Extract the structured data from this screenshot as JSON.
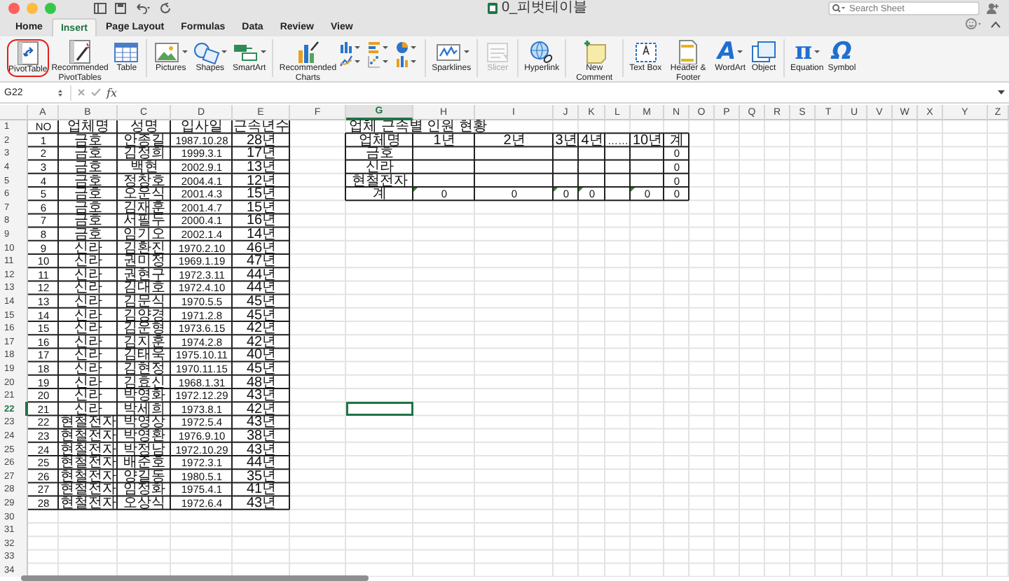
{
  "window": {
    "title": "0_피벗테이블"
  },
  "search": {
    "placeholder": "Search Sheet"
  },
  "tabs": [
    {
      "label": "Home",
      "selected": false
    },
    {
      "label": "Insert",
      "selected": true
    },
    {
      "label": "Page Layout",
      "selected": false
    },
    {
      "label": "Formulas",
      "selected": false
    },
    {
      "label": "Data",
      "selected": false
    },
    {
      "label": "Review",
      "selected": false
    },
    {
      "label": "View",
      "selected": false
    }
  ],
  "ribbon": {
    "groups": [
      {
        "kind": "buttons",
        "buttons": [
          {
            "label": "PivotTable",
            "circled": true,
            "disabled": false,
            "dropdown": false
          },
          {
            "label": "Recommended PivotTables",
            "circled": false,
            "disabled": false,
            "dropdown": false
          },
          {
            "label": "Table",
            "circled": false,
            "disabled": false,
            "dropdown": false
          }
        ]
      },
      {
        "kind": "buttons",
        "buttons": [
          {
            "label": "Pictures",
            "circled": false,
            "disabled": false,
            "dropdown": true
          },
          {
            "label": "Shapes",
            "circled": false,
            "disabled": false,
            "dropdown": true
          },
          {
            "label": "SmartArt",
            "circled": false,
            "disabled": false,
            "dropdown": true
          }
        ]
      },
      {
        "kind": "charts",
        "buttons": [
          {
            "label": "Recommended Charts",
            "circled": false,
            "disabled": false,
            "dropdown": false
          }
        ]
      },
      {
        "kind": "buttons",
        "buttons": [
          {
            "label": "Sparklines",
            "circled": false,
            "disabled": false,
            "dropdown": true
          }
        ]
      },
      {
        "kind": "buttons",
        "buttons": [
          {
            "label": "Slicer",
            "circled": false,
            "disabled": true,
            "dropdown": false
          }
        ]
      },
      {
        "kind": "buttons",
        "buttons": [
          {
            "label": "Hyperlink",
            "circled": false,
            "disabled": false,
            "dropdown": false
          }
        ]
      },
      {
        "kind": "buttons",
        "buttons": [
          {
            "label": "New Comment",
            "circled": false,
            "disabled": false,
            "dropdown": false
          }
        ]
      },
      {
        "kind": "buttons",
        "buttons": [
          {
            "label": "Text Box",
            "circled": false,
            "disabled": false,
            "dropdown": false
          },
          {
            "label": "Header & Footer",
            "circled": false,
            "disabled": false,
            "dropdown": false
          },
          {
            "label": "WordArt",
            "icon_glyph": "A",
            "circled": false,
            "disabled": false,
            "dropdown": true
          },
          {
            "label": "Object",
            "circled": false,
            "disabled": false,
            "dropdown": false
          }
        ]
      },
      {
        "kind": "buttons",
        "buttons": [
          {
            "label": "Equation",
            "icon_glyph": "π",
            "circled": false,
            "disabled": false,
            "dropdown": true
          },
          {
            "label": "Symbol",
            "icon_glyph": "Ω",
            "circled": false,
            "disabled": false,
            "dropdown": false
          }
        ]
      }
    ]
  },
  "formula_bar": {
    "name_box": "G22",
    "function_label": "fx"
  },
  "sheet": {
    "columns": [
      {
        "label": "A",
        "selected": false
      },
      {
        "label": "B",
        "selected": false
      },
      {
        "label": "C",
        "selected": false
      },
      {
        "label": "D",
        "selected": false
      },
      {
        "label": "E",
        "selected": false
      },
      {
        "label": "F",
        "selected": false
      },
      {
        "label": "G",
        "selected": true
      },
      {
        "label": "H",
        "selected": false
      },
      {
        "label": "I",
        "selected": false
      },
      {
        "label": "J",
        "selected": false
      },
      {
        "label": "K",
        "selected": false
      },
      {
        "label": "L",
        "selected": false
      },
      {
        "label": "M",
        "selected": false
      },
      {
        "label": "N",
        "selected": false
      },
      {
        "label": "O",
        "selected": false
      },
      {
        "label": "P",
        "selected": false
      },
      {
        "label": "Q",
        "selected": false
      },
      {
        "label": "R",
        "selected": false
      },
      {
        "label": "S",
        "selected": false
      },
      {
        "label": "T",
        "selected": false
      },
      {
        "label": "U",
        "selected": false
      },
      {
        "label": "V",
        "selected": false
      },
      {
        "label": "W",
        "selected": false
      },
      {
        "label": "X",
        "selected": false
      },
      {
        "label": "Y",
        "selected": false
      },
      {
        "label": "Z",
        "selected": false
      }
    ],
    "rows": [
      {
        "label": "1",
        "selected": false
      },
      {
        "label": "2",
        "selected": false
      },
      {
        "label": "3",
        "selected": false
      },
      {
        "label": "4",
        "selected": false
      },
      {
        "label": "5",
        "selected": false
      },
      {
        "label": "6",
        "selected": false
      },
      {
        "label": "7",
        "selected": false
      },
      {
        "label": "8",
        "selected": false
      },
      {
        "label": "9",
        "selected": false
      },
      {
        "label": "10",
        "selected": false
      },
      {
        "label": "11",
        "selected": false
      },
      {
        "label": "12",
        "selected": false
      },
      {
        "label": "13",
        "selected": false
      },
      {
        "label": "14",
        "selected": false
      },
      {
        "label": "15",
        "selected": false
      },
      {
        "label": "16",
        "selected": false
      },
      {
        "label": "17",
        "selected": false
      },
      {
        "label": "18",
        "selected": false
      },
      {
        "label": "19",
        "selected": false
      },
      {
        "label": "20",
        "selected": false
      },
      {
        "label": "21",
        "selected": false
      },
      {
        "label": "22",
        "selected": true
      },
      {
        "label": "23",
        "selected": false
      },
      {
        "label": "24",
        "selected": false
      },
      {
        "label": "25",
        "selected": false
      },
      {
        "label": "26",
        "selected": false
      },
      {
        "label": "27",
        "selected": false
      },
      {
        "label": "28",
        "selected": false
      },
      {
        "label": "29",
        "selected": false
      },
      {
        "label": "30",
        "selected": false
      },
      {
        "label": "31",
        "selected": false
      },
      {
        "label": "32",
        "selected": false
      },
      {
        "label": "33",
        "selected": false
      },
      {
        "label": "34",
        "selected": false
      }
    ],
    "employee_table": {
      "header": [
        "NO",
        "업체명",
        "성명",
        "입사일",
        "근속년수"
      ],
      "rows": [
        [
          "1",
          "금호",
          "안종길",
          "1987.10.28",
          "28년"
        ],
        [
          "2",
          "금호",
          "김정희",
          "1999.3.1",
          "17년"
        ],
        [
          "3",
          "금호",
          "백현",
          "2002.9.1",
          "13년"
        ],
        [
          "4",
          "금호",
          "정창호",
          "2004.4.1",
          "12년"
        ],
        [
          "5",
          "금호",
          "오운식",
          "2001.4.3",
          "15년"
        ],
        [
          "6",
          "금호",
          "김재훈",
          "2001.4.7",
          "15년"
        ],
        [
          "7",
          "금호",
          "서필두",
          "2000.4.1",
          "16년"
        ],
        [
          "8",
          "금호",
          "임기오",
          "2002.1.4",
          "14년"
        ],
        [
          "9",
          "신라",
          "김환진",
          "1970.2.10",
          "46년"
        ],
        [
          "10",
          "신라",
          "권미정",
          "1969.1.19",
          "47년"
        ],
        [
          "11",
          "신라",
          "권현구",
          "1972.3.11",
          "44년"
        ],
        [
          "12",
          "신라",
          "김대호",
          "1972.4.10",
          "44년"
        ],
        [
          "13",
          "신라",
          "김문식",
          "1970.5.5",
          "45년"
        ],
        [
          "14",
          "신라",
          "김양경",
          "1971.2.8",
          "45년"
        ],
        [
          "15",
          "신라",
          "김운형",
          "1973.6.15",
          "42년"
        ],
        [
          "16",
          "신라",
          "김지훈",
          "1974.2.8",
          "42년"
        ],
        [
          "17",
          "신라",
          "김태욱",
          "1975.10.11",
          "40년"
        ],
        [
          "18",
          "신라",
          "김현정",
          "1970.11.15",
          "45년"
        ],
        [
          "19",
          "신라",
          "김효신",
          "1968.1.31",
          "48년"
        ],
        [
          "20",
          "신라",
          "박영화",
          "1972.12.29",
          "43년"
        ],
        [
          "21",
          "신라",
          "박세희",
          "1973.8.1",
          "42년"
        ],
        [
          "22",
          "현철전자",
          "박영상",
          "1972.5.4",
          "43년"
        ],
        [
          "23",
          "현철전자",
          "박영환",
          "1976.9.10",
          "38년"
        ],
        [
          "24",
          "현철전자",
          "박정남",
          "1972.10.29",
          "43년"
        ],
        [
          "25",
          "현철전자",
          "배준호",
          "1972.3.1",
          "44년"
        ],
        [
          "26",
          "현철전자",
          "양길동",
          "1980.5.1",
          "35년"
        ],
        [
          "27",
          "현철전자",
          "임정화",
          "1975.4.1",
          "41년"
        ],
        [
          "28",
          "현철전자",
          "오상식",
          "1972.6.4",
          "43년"
        ]
      ]
    },
    "summary": {
      "title": "업체 근속별 인원 현황",
      "header": [
        "업체명",
        "1년",
        "2년",
        "3년",
        "4년",
        "……",
        "10년",
        "계"
      ],
      "rows": [
        {
          "label": "금호",
          "total": "0"
        },
        {
          "label": "신라",
          "total": "0"
        },
        {
          "label": "현철전자",
          "total": "0"
        }
      ],
      "total_row": {
        "label": "계",
        "values_before_gap": [
          {
            "text": "0",
            "flagged": true
          },
          {
            "text": "0",
            "flagged": false
          },
          {
            "text": "0",
            "flagged": true
          },
          {
            "text": "0",
            "flagged": true
          }
        ],
        "values_after_gap": [
          {
            "text": "0",
            "flagged": true
          }
        ],
        "total": "0"
      }
    }
  }
}
